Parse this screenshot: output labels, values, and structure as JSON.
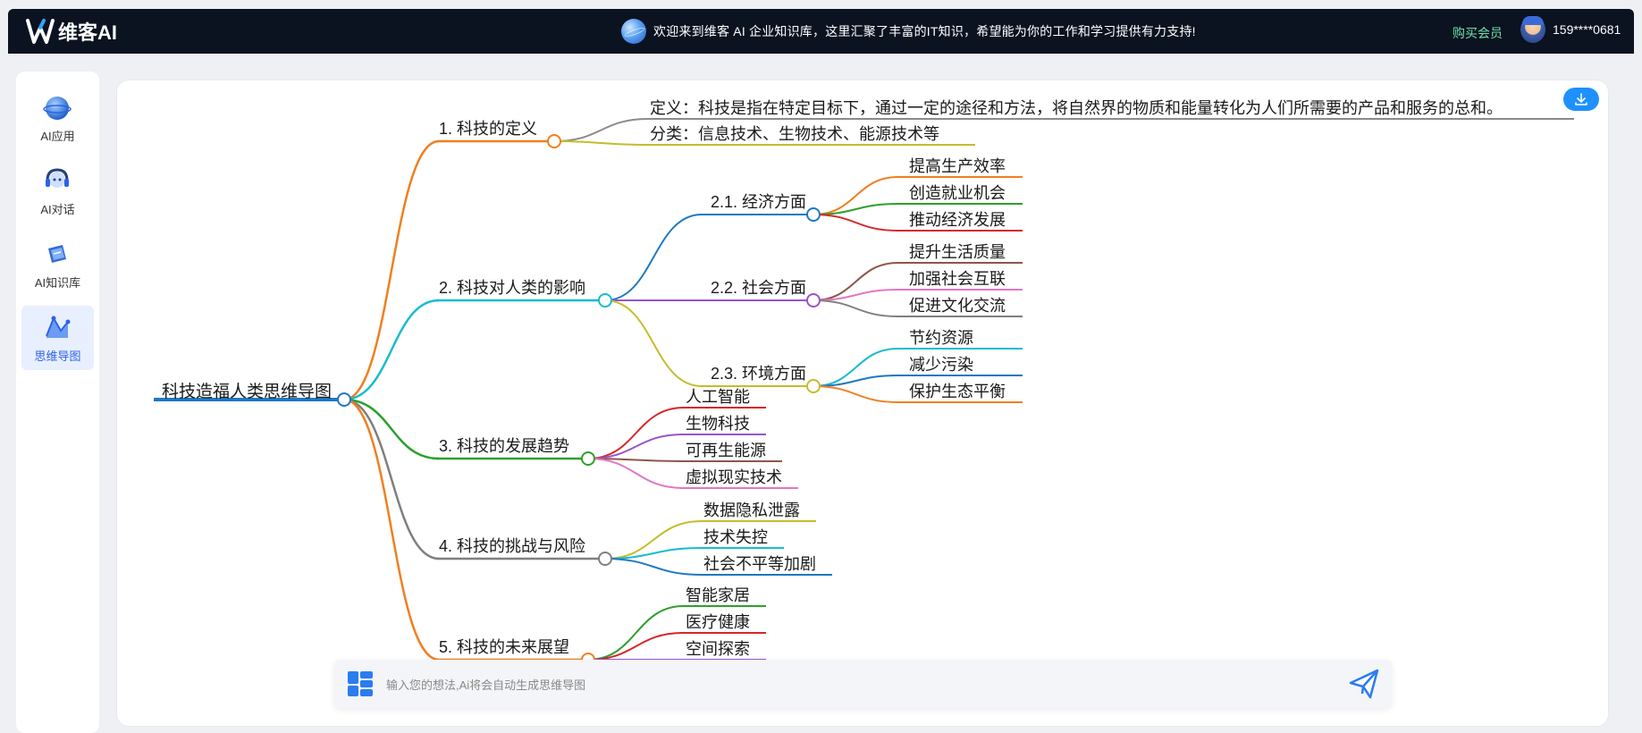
{
  "app": {
    "brand": "维客AI",
    "banner": "欢迎来到维客 AI 企业知识库，这里汇聚了丰富的IT知识，希望能为你的工作和学习提供有力支持!",
    "buy_label": "购买会员",
    "user_phone": "159****0681"
  },
  "sidebar": {
    "items": [
      {
        "label": "AI应用",
        "icon": "ai-app-icon"
      },
      {
        "label": "AI对话",
        "icon": "ai-chat-icon"
      },
      {
        "label": "AI知识库",
        "icon": "ai-knowledge-icon"
      },
      {
        "label": "思维导图",
        "icon": "mindmap-icon",
        "active": true
      }
    ]
  },
  "mindmap": {
    "root": "科技造福人类思维导图",
    "branches": [
      {
        "label": "1. 科技的定义",
        "color": "#f07f1e",
        "children": [
          {
            "label": "定义：科技是指在特定目标下，通过一定的途径和方法，将自然界的物质和能量转化为人们所需要的产品和服务的总和。",
            "color": "#8a8a8a"
          },
          {
            "label": "分类：信息技术、生物技术、能源技术等",
            "color": "#c5bc2a"
          }
        ]
      },
      {
        "label": "2. 科技对人类的影响",
        "color": "#17bcd0",
        "children": [
          {
            "label": "2.1. 经济方面",
            "color": "#1f78c1",
            "children": [
              {
                "label": "提高生产效率",
                "color": "#f07f1e"
              },
              {
                "label": "创造就业机会",
                "color": "#2ca02c"
              },
              {
                "label": "推动经济发展",
                "color": "#d62728"
              }
            ]
          },
          {
            "label": "2.2. 社会方面",
            "color": "#9a54c8",
            "children": [
              {
                "label": "提升生活质量",
                "color": "#8c564b"
              },
              {
                "label": "加强社会互联",
                "color": "#e377c2"
              },
              {
                "label": "促进文化交流",
                "color": "#7f7f7f"
              }
            ]
          },
          {
            "label": "2.3. 环境方面",
            "color": "#c5bc2a",
            "children": [
              {
                "label": "节约资源",
                "color": "#17bcd0"
              },
              {
                "label": "减少污染",
                "color": "#1f78c1"
              },
              {
                "label": "保护生态平衡",
                "color": "#f07f1e"
              }
            ]
          }
        ]
      },
      {
        "label": "3. 科技的发展趋势",
        "color": "#2ca02c",
        "children": [
          {
            "label": "人工智能",
            "color": "#d62728"
          },
          {
            "label": "生物科技",
            "color": "#9a54c8"
          },
          {
            "label": "可再生能源",
            "color": "#8c564b"
          },
          {
            "label": "虚拟现实技术",
            "color": "#e377c2"
          }
        ]
      },
      {
        "label": "4. 科技的挑战与风险",
        "color": "#7f7f7f",
        "children": [
          {
            "label": "数据隐私泄露",
            "color": "#c5bc2a"
          },
          {
            "label": "技术失控",
            "color": "#17bcd0"
          },
          {
            "label": "社会不平等加剧",
            "color": "#1f78c1"
          }
        ]
      },
      {
        "label": "5. 科技的未来展望",
        "color": "#f07f1e",
        "children": [
          {
            "label": "智能家居",
            "color": "#2ca02c"
          },
          {
            "label": "医疗健康",
            "color": "#d62728"
          },
          {
            "label": "空间探索",
            "color": "#9a54c8"
          }
        ]
      }
    ]
  },
  "input": {
    "placeholder": "输入您的想法,Ai将会自动生成思维导图"
  },
  "colors": {
    "root": "#1f78c1",
    "topbar": "#0b1220",
    "accent": "#1e90ff"
  }
}
